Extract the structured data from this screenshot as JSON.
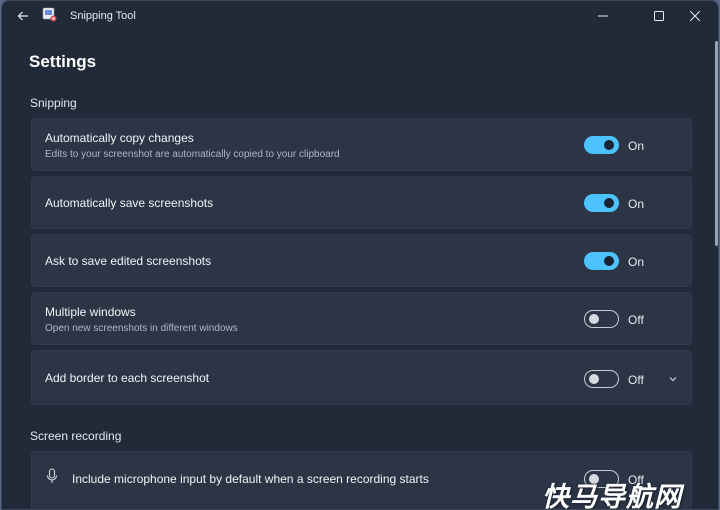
{
  "window": {
    "title": "Snipping Tool",
    "icons": {
      "back": "back-arrow-icon",
      "app": "snipping-tool-icon",
      "minimize": "minimize-icon",
      "maximize": "maximize-icon",
      "close": "close-icon"
    }
  },
  "page": {
    "title": "Settings"
  },
  "sections": {
    "snipping": {
      "title": "Snipping"
    },
    "recording": {
      "title": "Screen recording"
    }
  },
  "settings": [
    {
      "title": "Automatically copy changes",
      "subtitle": "Edits to your screenshot are automatically copied to your clipboard",
      "state": "On",
      "enabled": true
    },
    {
      "title": "Automatically save screenshots",
      "state": "On",
      "enabled": true
    },
    {
      "title": "Ask to save edited screenshots",
      "state": "On",
      "enabled": true
    },
    {
      "title": "Multiple windows",
      "subtitle": "Open new screenshots in different windows",
      "state": "Off",
      "enabled": false
    },
    {
      "title": "Add border to each screenshot",
      "state": "Off",
      "enabled": false,
      "expandable": true
    }
  ],
  "recording_settings": [
    {
      "title": "Include microphone input by default when a screen recording starts",
      "state": "Off",
      "enabled": false,
      "icon": "microphone-icon"
    }
  ],
  "watermark": {
    "text": "快马导航网"
  },
  "colors": {
    "accent": "#4cc2ff",
    "card": "#2b3545",
    "window": "#202a38"
  }
}
